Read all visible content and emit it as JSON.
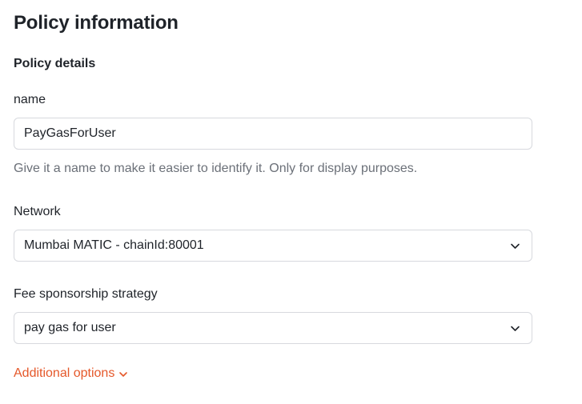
{
  "page": {
    "title": "Policy information"
  },
  "policy_details": {
    "section_title": "Policy details",
    "name": {
      "label": "name",
      "value": "PayGasForUser",
      "help": "Give it a name to make it easier to identify it. Only for display purposes."
    },
    "network": {
      "label": "Network",
      "selected": "Mumbai MATIC - chainId:80001"
    },
    "fee_strategy": {
      "label": "Fee sponsorship strategy",
      "selected": "pay gas for user"
    },
    "additional_options": {
      "label": "Additional options",
      "icon": "chevron-down-icon"
    }
  },
  "colors": {
    "accent": "#e5582a",
    "text": "#1f2329",
    "muted": "#6b7078",
    "border": "#d7d9de"
  }
}
